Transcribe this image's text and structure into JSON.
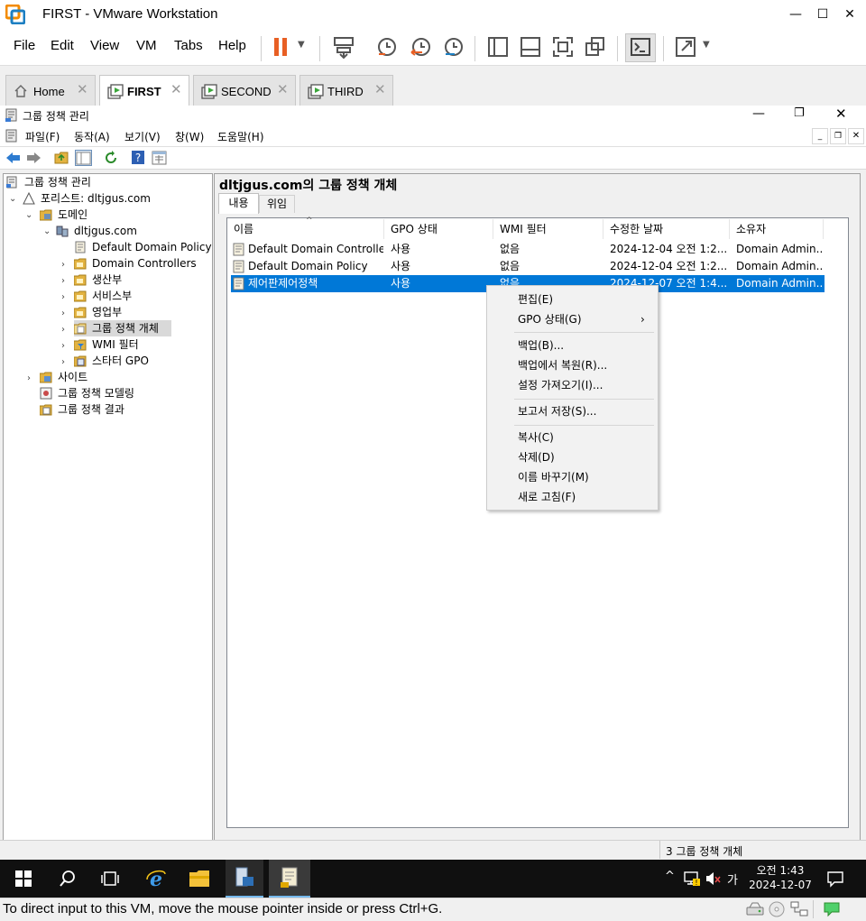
{
  "window": {
    "title": "FIRST - VMware Workstation",
    "controls": [
      "minimize",
      "maximize",
      "close"
    ]
  },
  "vm_menu": [
    "File",
    "Edit",
    "View",
    "VM",
    "Tabs",
    "Help"
  ],
  "vm_tabs": [
    {
      "label": "Home",
      "icon": "home-icon",
      "active": false
    },
    {
      "label": "FIRST",
      "icon": "vm-icon",
      "active": true
    },
    {
      "label": "SECOND",
      "icon": "vm-icon",
      "active": false
    },
    {
      "label": "THIRD",
      "icon": "vm-icon",
      "active": false
    }
  ],
  "gp_window": {
    "title": "그룹 정책 관리",
    "menu": [
      "파일(F)",
      "동작(A)",
      "보기(V)",
      "창(W)",
      "도움말(H)"
    ]
  },
  "tree": {
    "root": "그룹 정책 관리",
    "forest": "포리스트: dltjgus.com",
    "domains": "도메인",
    "domain": "dltjgus.com",
    "children": [
      "Default Domain Policy",
      "Domain Controllers",
      "생산부",
      "서비스부",
      "영업부",
      "그룹 정책 개체",
      "WMI 필터",
      "스타터 GPO"
    ],
    "sites": "사이트",
    "modeling": "그룹 정책 모델링",
    "results": "그룹 정책 결과"
  },
  "content": {
    "title": "dltjgus.com의 그룹 정책 개체",
    "tabs": [
      "내용",
      "위임"
    ],
    "columns": [
      "이름",
      "GPO 상태",
      "WMI 필터",
      "수정한 날짜",
      "소유자"
    ],
    "rows": [
      [
        "Default Domain Controlle...",
        "사용",
        "없음",
        "2024-12-04 오전 1:2...",
        "Domain Admin..."
      ],
      [
        "Default Domain Policy",
        "사용",
        "없음",
        "2024-12-04 오전 1:2...",
        "Domain Admin..."
      ],
      [
        "제어판제어정책",
        "사용",
        "없음",
        "2024-12-07 오전 1:4...",
        "Domain Admin..."
      ]
    ],
    "selected_row": 2
  },
  "context_menu": {
    "groups": [
      [
        "편집(E)",
        "GPO 상태(G)"
      ],
      [
        "백업(B)...",
        "백업에서 복원(R)...",
        "설정 가져오기(I)..."
      ],
      [
        "보고서 저장(S)..."
      ],
      [
        "복사(C)",
        "삭제(D)",
        "이름 바꾸기(M)",
        "새로 고침(F)"
      ]
    ]
  },
  "status": {
    "text": "3 그룹 정책 개체"
  },
  "taskbar": {
    "time": "오전 1:43",
    "date": "2024-12-07",
    "ime": "가"
  },
  "vm_status": {
    "hint": "To direct input to this VM, move the mouse pointer inside or press Ctrl+G."
  },
  "colors": {
    "selection": "#0078d7",
    "taskbar": "#101010",
    "pause": "#e85f24"
  }
}
